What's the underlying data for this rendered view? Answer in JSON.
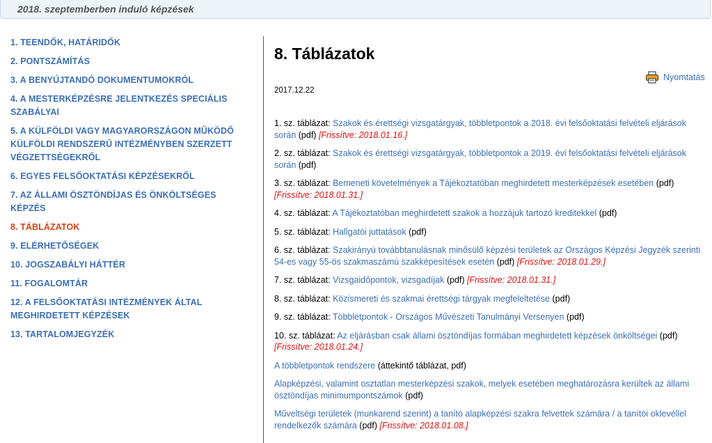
{
  "header": {
    "title": "2018. szeptemberben induló képzések"
  },
  "sidebar": {
    "items": [
      {
        "label": "1. TEENDŐK, HATÁRIDŐK",
        "active": false
      },
      {
        "label": "2. PONTSZÁMÍTÁS",
        "active": false
      },
      {
        "label": "3. A BENYÚJTANDÓ DOKUMENTUMOKRÓL",
        "active": false
      },
      {
        "label": "4. A MESTERKÉPZÉSRE JELENTKEZÉS SPECIÁLIS SZABÁLYAI",
        "active": false
      },
      {
        "label": "5. A KÜLFÖLDI VAGY MAGYARORSZÁGON MŰKÖDŐ KÜLFÖLDI RENDSZERŰ INTÉZMÉNYBEN SZERZETT VÉGZETTSÉGEKRŐL",
        "active": false
      },
      {
        "label": "6. EGYES FELSŐOKTATÁSI KÉPZÉSEKRŐL",
        "active": false
      },
      {
        "label": "7. AZ ÁLLAMI ÖSZTÖNDÍJAS ÉS ÖNKÖLTSÉGES KÉPZÉS",
        "active": false
      },
      {
        "label": "8. TÁBLÁZATOK",
        "active": true
      },
      {
        "label": "9. ELÉRHETŐSÉGEK",
        "active": false
      },
      {
        "label": "10. JOGSZABÁLYI HÁTTÉR",
        "active": false
      },
      {
        "label": "11. FOGALOMTÁR",
        "active": false
      },
      {
        "label": "12. A FELSŐOKTATÁSI INTÉZMÉNYEK ÁLTAL MEGHIRDETETT KÉPZÉSEK",
        "active": false
      },
      {
        "label": "13. TARTALOMJEGYZÉK",
        "active": false
      }
    ]
  },
  "main": {
    "title": "8. Táblázatok",
    "print_label": "Nyomtatás",
    "print_icon": "printer-icon",
    "date": "2017.12.22",
    "entries": [
      {
        "prefix": "1. sz. táblázat: ",
        "link": "Szakok és érettségi vizsgatárgyak, többletpontok a 2018. évi felsőoktatási felvételi eljárások során",
        "suffix": " (pdf) ",
        "updated": "[Frissítve: 2018.01.16.]"
      },
      {
        "prefix": "2. sz. táblázat: ",
        "link": "Szakok és érettségi vizsgatárgyak, többletpontok a 2019. évi felsőoktatási felvételi eljárások során",
        "suffix": " (pdf)",
        "updated": ""
      },
      {
        "prefix": "3. sz. táblázat: ",
        "link": "Bemeneti követelmények a Tájékoztatóban meghirdetett mesterképzések esetében",
        "suffix": " (pdf) ",
        "updated": "[Frissítve: 2018.01.31.]"
      },
      {
        "prefix": "4. sz. táblázat: ",
        "link": "A Tájékoztatóban meghirdetett szakok a hozzájuk tartozó kreditekkel",
        "suffix": " (pdf)",
        "updated": ""
      },
      {
        "prefix": "5. sz. táblázat: ",
        "link": "Hallgatói juttatások",
        "suffix": " (pdf)",
        "updated": ""
      },
      {
        "prefix": "6. sz. táblázat: ",
        "link": "Szakirányú továbbtanulásnak minősülő képzési területek az Országos Képzési Jegyzék szerinti 54-es vagy 55-ös szakmaszámú szakképesítések esetén",
        "suffix": " (pdf) ",
        "updated": "[Frissítve: 2018.01.29.]"
      },
      {
        "prefix": "7. sz. táblázat: ",
        "link": "Vizsgaidőpontok, vizsgadíjak",
        "suffix": " (pdf) ",
        "updated": "[Frissítve: 2018.01.31.]"
      },
      {
        "prefix": "8. sz. táblázat: ",
        "link": "Közismereti és szakmai érettségi tárgyak megfeleltetése",
        "suffix": " (pdf)",
        "updated": ""
      },
      {
        "prefix": "9. sz. táblázat: ",
        "link": "Többletpontok - Országos Művészeti Tanulmányi Versenyen",
        "suffix": " (pdf)",
        "updated": ""
      },
      {
        "prefix": "10. sz. táblázat: ",
        "link": "Az eljárásban csak állami ösztöndíjas formában meghirdetett képzések önköltségei",
        "suffix": " (pdf) ",
        "updated": "[Frissítve: 2018.01.24.]"
      },
      {
        "prefix": "",
        "link": "A többletpontok rendszere",
        "suffix": " (áttekintő táblázat, pdf)",
        "updated": ""
      },
      {
        "prefix": "",
        "link": "Alapképzési, valamint osztatlan mesterképzési szakok, melyek esetében meghatározásra kerültek az állami ösztöndíjas minimumpontszámok",
        "suffix": " (pdf)",
        "updated": ""
      },
      {
        "prefix": "",
        "link": "Műveltségi területek (munkarend szerint) a tanító alapképzési szakra felvettek számára / a tanítói oklevéllel rendelkezők számára",
        "suffix": " (pdf) ",
        "updated": "[Frissítve: 2018.01.08.]"
      }
    ]
  }
}
